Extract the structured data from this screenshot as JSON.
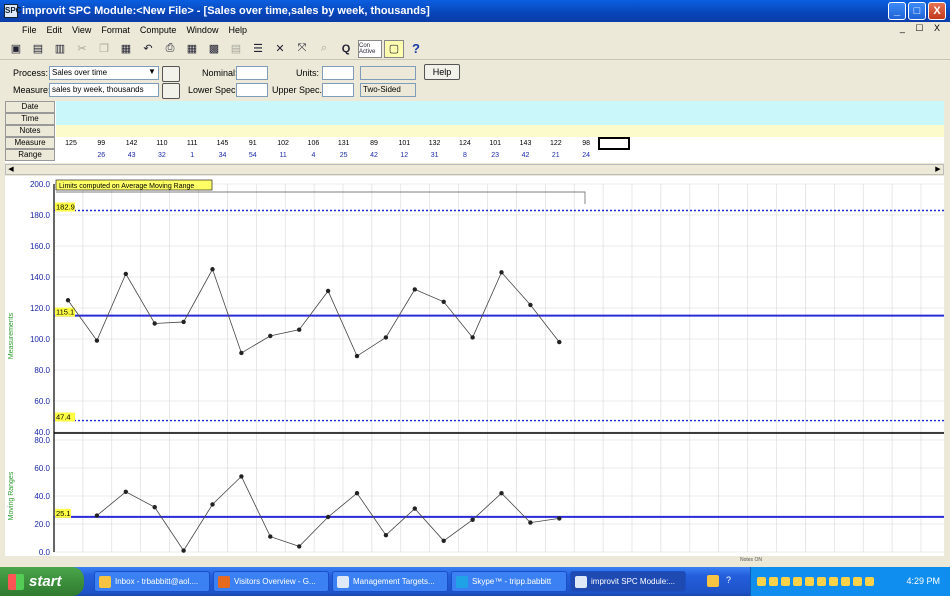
{
  "window": {
    "title": "improvit SPC Module:<New File> - [Sales over time,sales by week, thousands]",
    "controls": [
      "_",
      "□",
      "X"
    ]
  },
  "menu": [
    "File",
    "Edit",
    "View",
    "Format",
    "Compute",
    "Window",
    "Help"
  ],
  "mdi_controls": "_ ☐ X",
  "toolbar": {
    "con_active_label": "Con Active",
    "q_label": "Q",
    "help_label": "?"
  },
  "form": {
    "process_label": "Process:",
    "process_value": "Sales over time",
    "measure_label": "Measure:",
    "measure_value": "sales by week, thousands",
    "nominal_label": "Nominal:",
    "nominal_value": "",
    "units_label": "Units:",
    "units_value": "",
    "lower_spec_label": "Lower Spec.:",
    "lower_spec_value": "",
    "upper_spec_label": "Upper Spec.:",
    "upper_spec_value": "",
    "sidedness": "Two-Sided",
    "help_button": "Help"
  },
  "grid": {
    "row_labels": [
      "Date",
      "Time",
      "Notes",
      "Measure",
      "Range"
    ],
    "measures": [
      "125",
      "99",
      "142",
      "110",
      "111",
      "145",
      "91",
      "102",
      "106",
      "131",
      "89",
      "101",
      "132",
      "124",
      "101",
      "143",
      "122",
      "98"
    ],
    "ranges": [
      "",
      "26",
      "43",
      "32",
      "1",
      "34",
      "54",
      "11",
      "4",
      "25",
      "42",
      "12",
      "31",
      "8",
      "23",
      "42",
      "21",
      "24"
    ]
  },
  "chart_data": [
    {
      "type": "line",
      "ylabel": "Measurements",
      "ylim": [
        40,
        200
      ],
      "yticks": [
        "200.0",
        "180.0",
        "160.0",
        "140.0",
        "120.0",
        "100.0",
        "80.0",
        "60.0",
        "40.0"
      ],
      "annotation": "Limits computed on Average Moving Range",
      "ucl": {
        "value": 182.9,
        "label": "182.9"
      },
      "center": {
        "value": 115.1,
        "label": "115.1"
      },
      "lcl": {
        "value": 47.4,
        "label": "47.4"
      },
      "values": [
        125,
        99,
        142,
        110,
        111,
        145,
        91,
        102,
        106,
        131,
        89,
        101,
        132,
        124,
        101,
        143,
        122,
        98
      ]
    },
    {
      "type": "line",
      "ylabel": "Moving Ranges",
      "ylim": [
        0,
        80
      ],
      "yticks": [
        "80.0",
        "60.0",
        "40.0",
        "20.0",
        "0.0"
      ],
      "center": {
        "value": 25.1,
        "label": "25.1"
      },
      "values": [
        null,
        26,
        43,
        32,
        1,
        34,
        54,
        11,
        4,
        25,
        42,
        12,
        31,
        8,
        23,
        42,
        21,
        24
      ]
    }
  ],
  "status": {
    "note": "Notes ON"
  },
  "taskbar": {
    "start_label": "start",
    "tasks": [
      "Inbox - trbabbitt@aol....",
      "Visitors Overview - G...",
      "Management Targets...",
      "Skype™ - tripp.babbitt",
      "improvit SPC Module:..."
    ],
    "clock": "4:29 PM"
  }
}
